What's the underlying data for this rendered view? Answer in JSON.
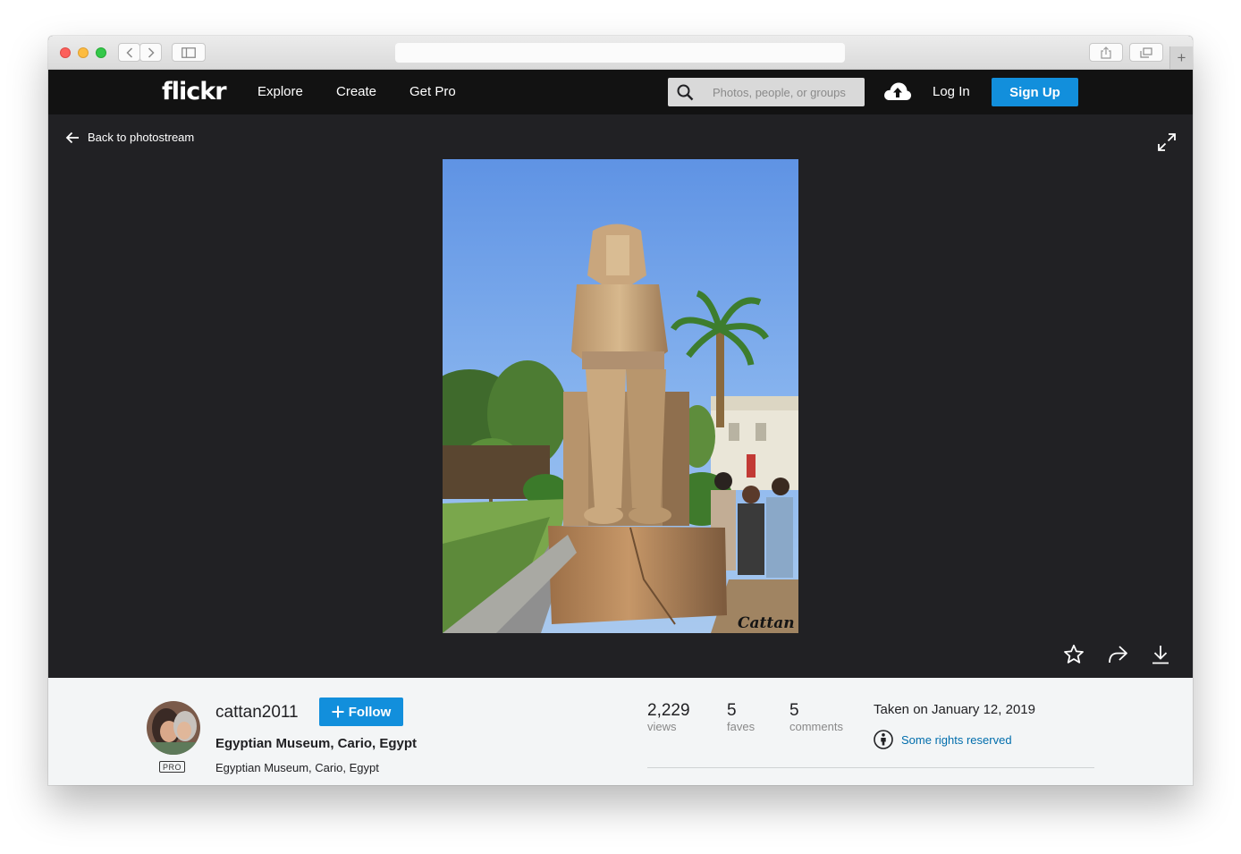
{
  "browser": {
    "address_text": "",
    "new_tab_label": "+"
  },
  "nav": {
    "logo": "flickr",
    "links": [
      "Explore",
      "Create",
      "Get Pro"
    ],
    "search_placeholder": "Photos, people, or groups",
    "login_label": "Log In",
    "signup_label": "Sign Up"
  },
  "stage": {
    "back_label": "Back to photostream",
    "watermark": "Cattan"
  },
  "photo": {
    "owner": "cattan2011",
    "owner_badge": "PRO",
    "follow_label": "Follow",
    "title": "Egyptian Museum, Cario, Egypt",
    "description": "Egyptian Museum, Cario, Egypt",
    "stats": [
      {
        "value": "2,229",
        "label": "views"
      },
      {
        "value": "5",
        "label": "faves"
      },
      {
        "value": "5",
        "label": "comments"
      }
    ],
    "taken": "Taken on January 12, 2019",
    "license": "Some rights reserved"
  },
  "colors": {
    "accent": "#128fdc",
    "nav_bg": "#121212",
    "stage_bg": "#212124",
    "info_bg": "#f3f5f6",
    "link": "#006dac"
  }
}
